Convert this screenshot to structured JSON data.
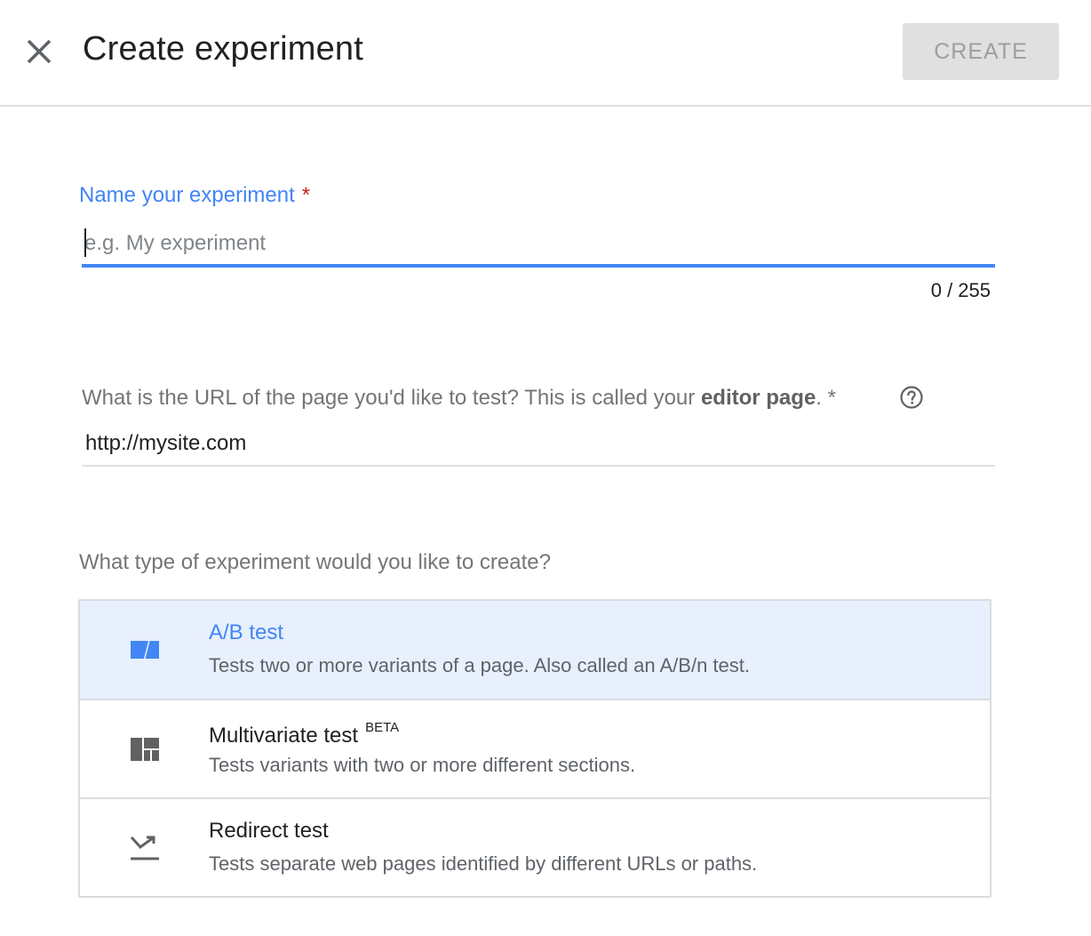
{
  "header": {
    "title": "Create experiment",
    "create_label": "CREATE",
    "close_icon": "close-icon"
  },
  "name_field": {
    "label": "Name your experiment",
    "required_mark": "*",
    "placeholder": "e.g. My experiment",
    "value": "",
    "counter": "0 / 255"
  },
  "url_field": {
    "label_prefix": "What is the URL of the page you'd like to test? This is called your ",
    "label_bold": "editor page",
    "label_suffix": ". *",
    "help_icon": "help-circle-icon",
    "value": "http://mysite.com"
  },
  "experiment_type": {
    "question": "What type of experiment would you like to create?",
    "options": [
      {
        "title": "A/B test",
        "badge": "",
        "description": "Tests two or more variants of a page. Also called an A/B/n test.",
        "icon": "ab-test-icon",
        "selected": true
      },
      {
        "title": "Multivariate test",
        "badge": "BETA",
        "description": "Tests variants with two or more different sections.",
        "icon": "multivariate-icon",
        "selected": false
      },
      {
        "title": "Redirect test",
        "badge": "",
        "description": "Tests separate web pages identified by different URLs or paths.",
        "icon": "redirect-icon",
        "selected": false
      }
    ]
  },
  "colors": {
    "accent": "#4285f4",
    "required": "#c5221f",
    "selected_bg": "#e8f0fe",
    "disabled_button_bg": "#e0e0e0"
  }
}
